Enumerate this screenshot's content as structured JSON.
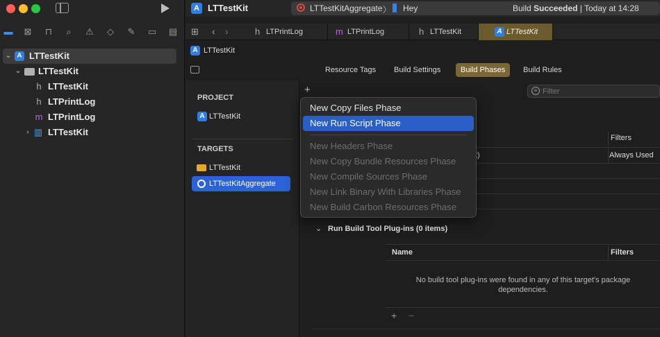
{
  "toolbar": {
    "title": "LTTestKit",
    "scheme": "LTTestKitAggregate",
    "scheme_separator": "〉",
    "device": "Hey",
    "status_prefix": "Build ",
    "status_strong": "Succeeded",
    "status_suffix": " | Today at 14:28"
  },
  "navigator": {
    "items": [
      {
        "label": "LTTestKit"
      },
      {
        "label": "LTTestKit"
      },
      {
        "label": "LTTestKit",
        "glyph": "h"
      },
      {
        "label": "LTPrintLog",
        "glyph": "h"
      },
      {
        "label": "LTPrintLog",
        "glyph": "m"
      },
      {
        "label": "LTTestKit"
      }
    ]
  },
  "tabs": [
    {
      "glyph": "h",
      "label": "LTPrintLog"
    },
    {
      "glyph": "m",
      "label": "LTPrintLog"
    },
    {
      "glyph": "h",
      "label": "LTTestKit"
    },
    {
      "label": "LTTestKit"
    }
  ],
  "breadcrumb": {
    "label": "LTTestKit"
  },
  "editor_tabs": [
    "Resource Tags",
    "Build Settings",
    "Build Phases",
    "Build Rules"
  ],
  "sidebar": {
    "project_header": "PROJECT",
    "project_item": "LTTestKit",
    "targets_header": "TARGETS",
    "targets": [
      "LTTestKit",
      "LTTestKitAggregate"
    ]
  },
  "phases": {
    "add_symbol": "+",
    "filter_placeholder": "Filter",
    "table1": {
      "col_filters": "Filters",
      "row_partial": "t)",
      "row_filters": "Always Used"
    },
    "plugin_section": "Run Build Tool Plug-ins (0 items)",
    "plugin_col_name": "Name",
    "plugin_col_filters": "Filters",
    "plugin_empty_line1": "No build tool plug-ins were found in any of this target's package",
    "plugin_empty_line2": "dependencies.",
    "plus": "+",
    "minus": "−"
  },
  "menu": {
    "items": [
      {
        "label": "New Copy Files Phase",
        "state": "normal"
      },
      {
        "label": "New Run Script Phase",
        "state": "highlighted"
      },
      {
        "label": "New Headers Phase",
        "state": "disabled"
      },
      {
        "label": "New Copy Bundle Resources Phase",
        "state": "disabled"
      },
      {
        "label": "New Compile Sources Phase",
        "state": "disabled"
      },
      {
        "label": "New Link Binary With Libraries Phase",
        "state": "disabled"
      },
      {
        "label": "New Build Carbon Resources Phase",
        "state": "disabled"
      }
    ]
  },
  "colors": {
    "accent": "#2b63d6",
    "tab_active": "#6b5a2b",
    "segment_active": "#7a6733"
  }
}
